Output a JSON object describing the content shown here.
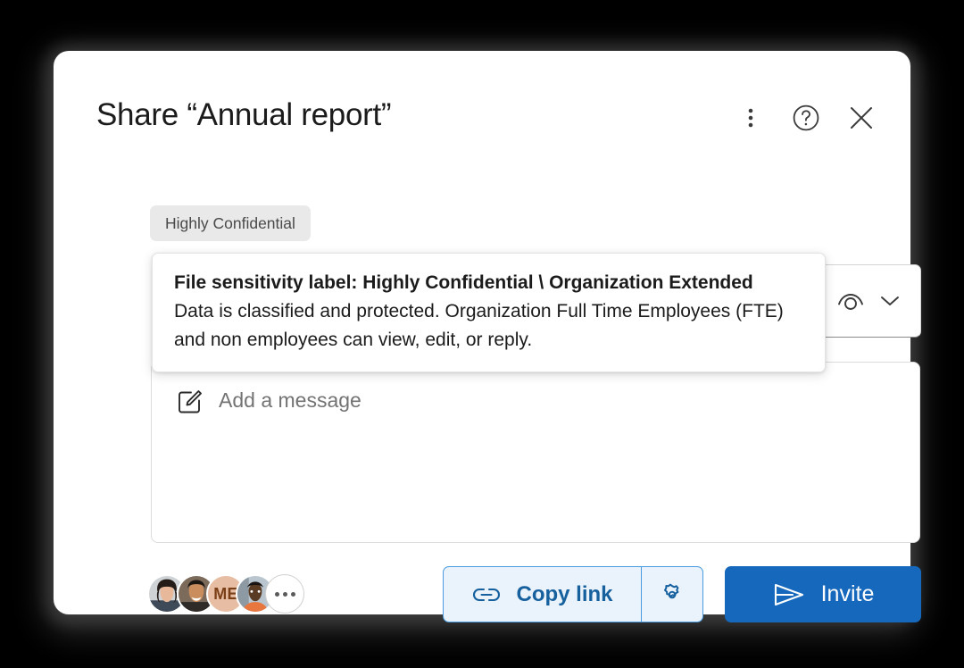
{
  "dialog": {
    "title": "Share “Annual report”",
    "sensitivity_badge": "Highly Confidential",
    "header_actions": [
      {
        "name": "more-options",
        "icon": "more-vertical-icon"
      },
      {
        "name": "help",
        "icon": "help-circle-icon"
      },
      {
        "name": "close",
        "icon": "close-icon"
      }
    ]
  },
  "tooltip": {
    "title": "File sensitivity label: Highly Confidential \\ Organization Extended",
    "body": "Data is classified and protected. Organization Full Time Employees (FTE) and non employees can view, edit, or reply."
  },
  "permission": {
    "icon": "eye-icon",
    "chevron": "chevron-down-icon"
  },
  "message": {
    "icon": "edit-square-icon",
    "placeholder": "Add a message",
    "value": ""
  },
  "avatars": [
    {
      "name": "avatar-person-1",
      "type": "photo",
      "tone": "#3c2f2a"
    },
    {
      "name": "avatar-person-2",
      "type": "photo",
      "tone": "#6b4a34"
    },
    {
      "name": "avatar-me",
      "type": "initials",
      "initials": "ME",
      "bg": "#e7bda3",
      "fg": "#7a3f17"
    },
    {
      "name": "avatar-person-4",
      "type": "photo",
      "tone": "#4a3a2e"
    },
    {
      "name": "avatar-overflow",
      "type": "overflow",
      "label": "..."
    }
  ],
  "footer": {
    "copy_link_label": "Copy link",
    "copy_link_icon": "link-icon",
    "link_settings_icon": "gear-icon",
    "invite_label": "Invite",
    "invite_icon": "send-icon"
  },
  "colors": {
    "accent": "#1668bc",
    "accent_text": "#16609e",
    "accent_soft_bg": "#eaf3fc",
    "accent_border": "#4a9bdf",
    "badge_bg": "#e9e9e9",
    "page_bg": "#000000"
  }
}
